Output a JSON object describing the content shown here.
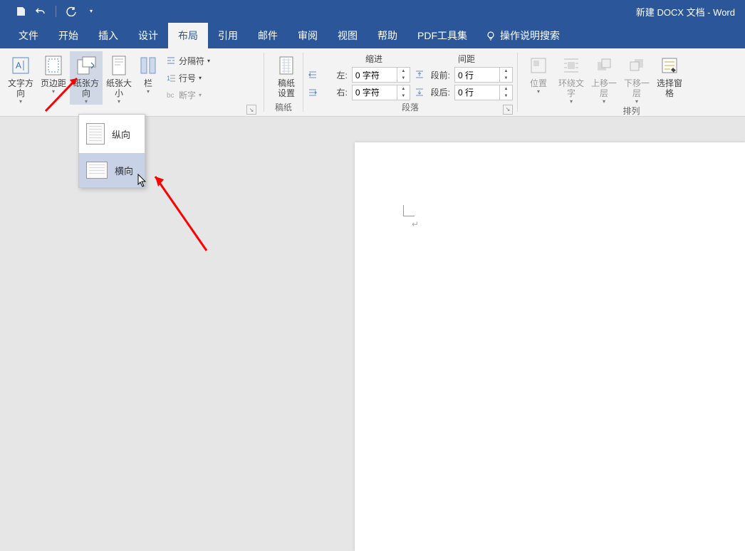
{
  "title": "新建 DOCX 文档  -  Word",
  "tabs": {
    "file": "文件",
    "home": "开始",
    "insert": "插入",
    "design": "设计",
    "layout": "布局",
    "references": "引用",
    "mailings": "邮件",
    "review": "审阅",
    "view": "视图",
    "help": "帮助",
    "pdf": "PDF工具集",
    "tellme": "操作说明搜索"
  },
  "page_setup": {
    "text_direction": "文字方向",
    "margins": "页边距",
    "orientation": "纸张方向",
    "size": "纸张大小",
    "columns": "栏"
  },
  "page_setup_small": {
    "breaks": "分隔符",
    "line_numbers": "行号",
    "hyphenation": "断字"
  },
  "gaozhi": {
    "btn": "稿纸\n设置",
    "label": "稿纸"
  },
  "paragraph": {
    "indent_title": "缩进",
    "spacing_title": "间距",
    "left_lbl": "左:",
    "left_val": "0 字符",
    "right_lbl": "右:",
    "right_val": "0 字符",
    "before_lbl": "段前:",
    "before_val": "0 行",
    "after_lbl": "段后:",
    "after_val": "0 行",
    "group_label": "段落"
  },
  "arrange": {
    "position": "位置",
    "wrap": "环绕文字",
    "bring_forward": "上移一层",
    "send_backward": "下移一层",
    "selection_pane": "选择窗格",
    "group_label": "排列"
  },
  "orient_menu": {
    "portrait": "纵向",
    "landscape": "横向"
  }
}
